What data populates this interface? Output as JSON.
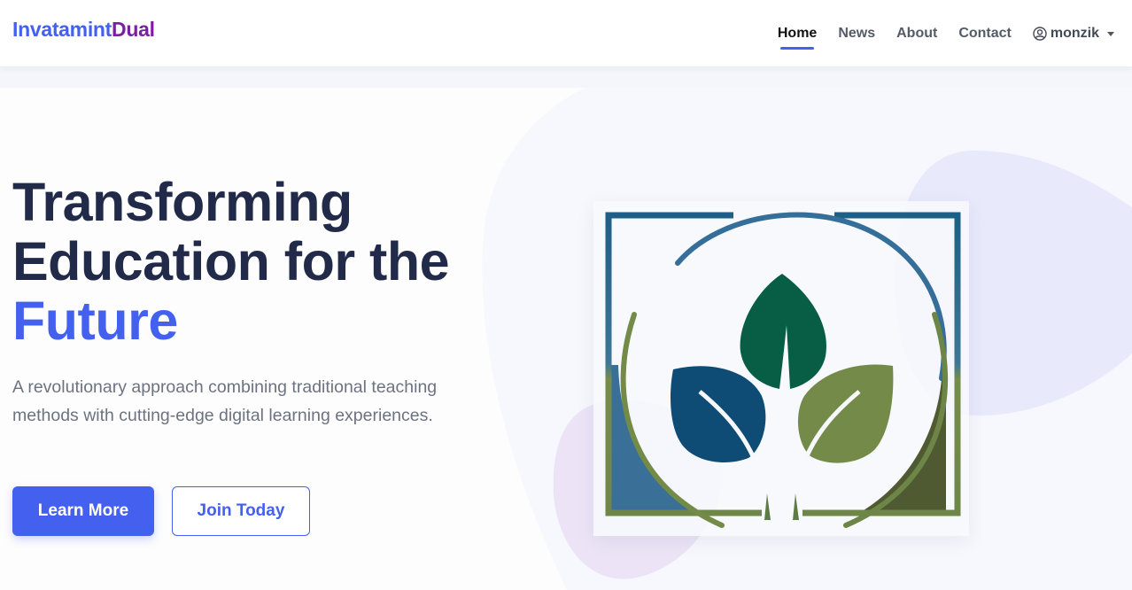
{
  "brand": {
    "part1": "Invatamint",
    "part2": "Dual"
  },
  "nav": {
    "links": [
      {
        "label": "Home",
        "active": true
      },
      {
        "label": "News"
      },
      {
        "label": "About"
      },
      {
        "label": "Contact"
      }
    ],
    "user": {
      "name": "monzik",
      "icon": "user-circle-icon"
    }
  },
  "hero": {
    "title_line1": "Transforming",
    "title_line2": "Education for the",
    "title_accent": "Future",
    "description": "A revolutionary approach combining traditional teaching methods with cutting-edge digital learning experiences.",
    "primary_button": "Learn More",
    "secondary_button": "Join Today",
    "image_icon": "leaf-logo"
  },
  "colors": {
    "accent": "#4361ee",
    "brand_secondary": "#7a1fa2",
    "heading": "#222a4a",
    "leaf_green": "#075e45",
    "leaf_blue": "#0f4c75",
    "leaf_olive": "#748a48"
  }
}
